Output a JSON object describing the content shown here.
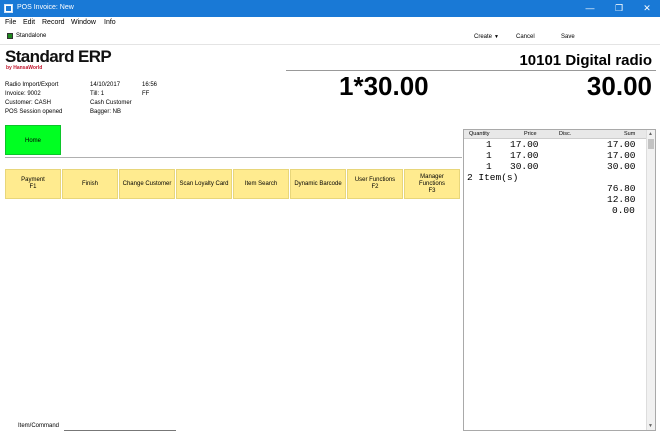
{
  "window": {
    "title": "POS Invoice: New",
    "minimize": "—",
    "maximize": "❐",
    "close": "✕"
  },
  "menubar": [
    "File",
    "Edit",
    "Record",
    "Window",
    "Info"
  ],
  "toolbar": {
    "standalone_label": "Standalone",
    "create_label": "Create",
    "cancel_label": "Cancel",
    "save_label": "Save"
  },
  "brand": {
    "name": "Standard ERP",
    "sub": "by HansaWorld"
  },
  "info": {
    "station": "Radio Import/Export",
    "date": "14/10/2017",
    "time": "16:56",
    "invoice": "Invoice: 9002",
    "till": "Till: 1",
    "till_code": "FF",
    "customer": "Customer: CASH",
    "customer_name": "Cash Customer",
    "session": "POS Session opened",
    "bagger": "Bagger: NB"
  },
  "display": {
    "item": "10101 Digital radio",
    "qty_price": "1*30.00",
    "total": "30.00"
  },
  "home_button": "Home",
  "function_buttons": [
    "Payment\nF1",
    "Finish",
    "Change Customer",
    "Scan Loyalty Card",
    "Item Search",
    "Dynamic Barcode",
    "User Functions\nF2",
    "Manager\nFunctions\nF3"
  ],
  "receipt": {
    "headers": {
      "quantity": "Quantity",
      "price": "Price",
      "disc": "Disc.",
      "sum": "Sum"
    },
    "rows": [
      {
        "qty": "1",
        "price": "17.00",
        "disc": "",
        "sum": "17.00"
      },
      {
        "qty": "1",
        "price": "17.00",
        "disc": "",
        "sum": "17.00"
      },
      {
        "qty": "1",
        "price": "30.00",
        "disc": "",
        "sum": "30.00"
      }
    ],
    "item_count": "2 Item(s)",
    "totals": [
      "76.80",
      "12.80",
      "0.00"
    ]
  },
  "command": {
    "label": "Item/Command",
    "value": ""
  },
  "colors": {
    "titlebar": "#1979d6",
    "home_button": "#00ff22",
    "function_button": "#ffeb8f",
    "logo_sub": "#c0152c"
  }
}
